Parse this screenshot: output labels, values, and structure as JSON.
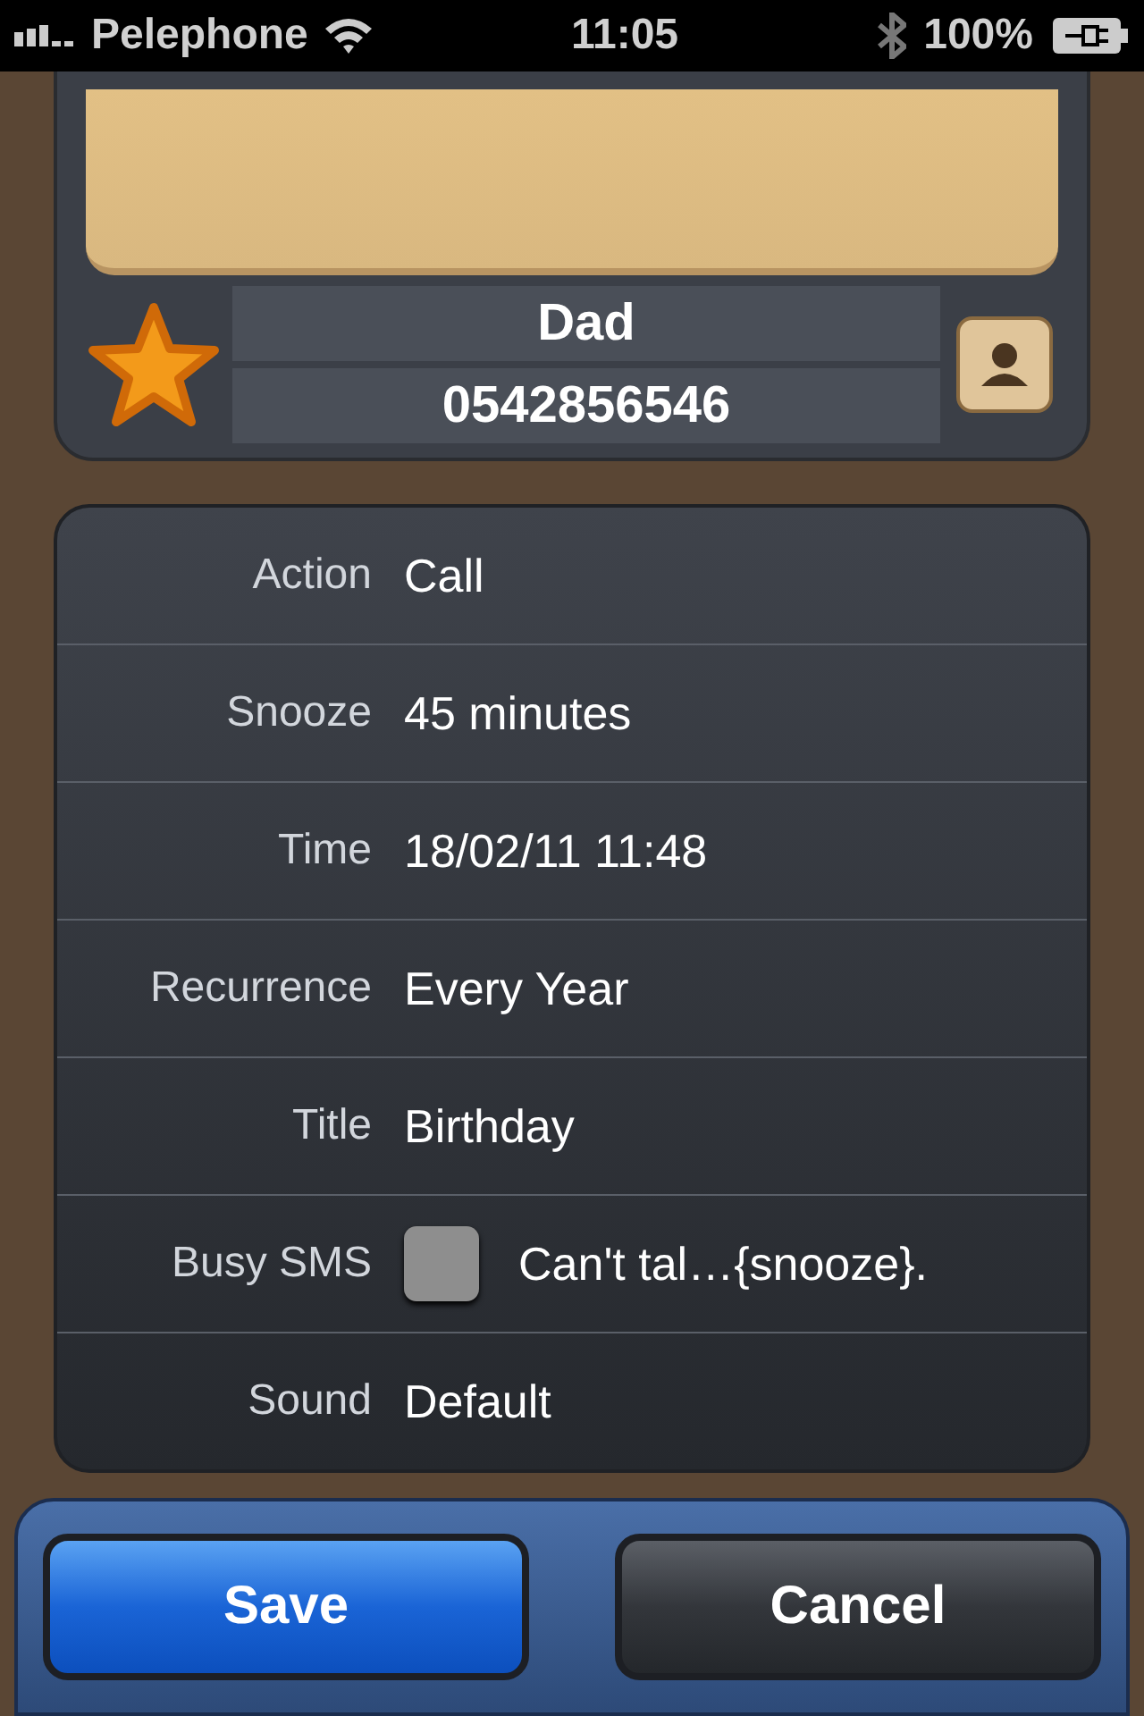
{
  "status_bar": {
    "carrier": "Pelephone",
    "time": "11:05",
    "battery": "100%"
  },
  "contact": {
    "name": "Dad",
    "phone": "0542856546",
    "favorite": true
  },
  "settings": [
    {
      "kind": "text",
      "label": "Action",
      "value": "Call"
    },
    {
      "kind": "text",
      "label": "Snooze",
      "value": "45 minutes"
    },
    {
      "kind": "text",
      "label": "Time",
      "value": "18/02/11 11:48"
    },
    {
      "kind": "text",
      "label": "Recurrence",
      "value": "Every Year"
    },
    {
      "kind": "text",
      "label": "Title",
      "value": "Birthday"
    },
    {
      "kind": "checkbox",
      "label": "Busy SMS",
      "checked": false,
      "value": "Can't tal…{snooze}."
    },
    {
      "kind": "text",
      "label": "Sound",
      "value": "Default"
    }
  ],
  "buttons": [
    {
      "kind": "primary",
      "label": "Save"
    },
    {
      "kind": "secondary",
      "label": "Cancel"
    }
  ]
}
